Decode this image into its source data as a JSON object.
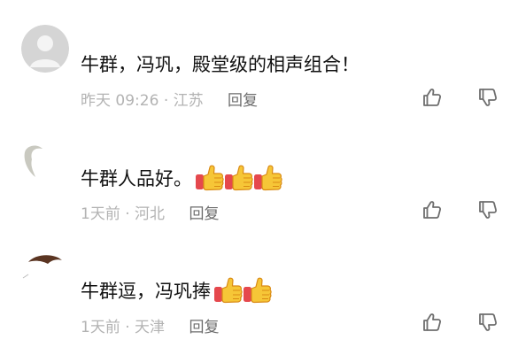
{
  "comments": [
    {
      "username": "",
      "text": "牛群，冯巩，殿堂级的相声组合！",
      "emoji": [],
      "time": "昨天 09:26",
      "location": "江苏",
      "reply_label": "回复"
    },
    {
      "username": "",
      "text": "牛群人品好。",
      "emoji": [
        "thumbs-up",
        "thumbs-up",
        "thumbs-up"
      ],
      "time": "1天前",
      "location": "河北",
      "reply_label": "回复"
    },
    {
      "username": "",
      "text": "牛群逗，冯巩捧",
      "emoji": [
        "thumbs-up",
        "thumbs-up"
      ],
      "time": "1天前",
      "location": "天津",
      "reply_label": "回复"
    }
  ],
  "separator": "·",
  "colors": {
    "text": "#111111",
    "meta": "#b3b3b3",
    "reply": "#6c6c6c",
    "thumb_fill": "#f6c637",
    "cuff": "#e5484d"
  }
}
